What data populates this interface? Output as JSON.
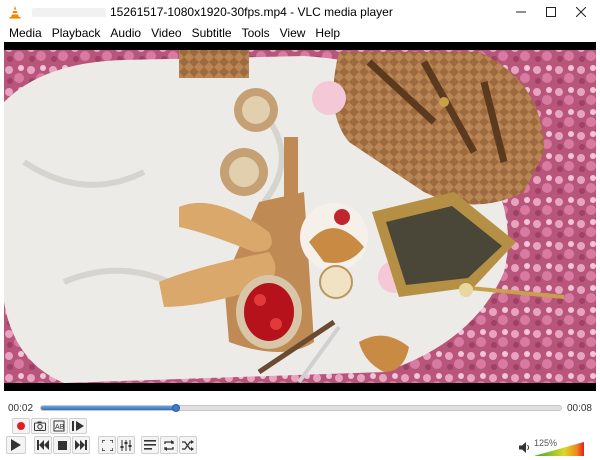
{
  "window": {
    "title": "15261517-1080x1920-30fps.mp4 - VLC media player",
    "controls": [
      "minimize",
      "maximize",
      "close"
    ]
  },
  "menu": [
    {
      "label": "Media"
    },
    {
      "label": "Playback"
    },
    {
      "label": "Audio"
    },
    {
      "label": "Video"
    },
    {
      "label": "Subtitle"
    },
    {
      "label": "Tools"
    },
    {
      "label": "View"
    },
    {
      "label": "Help"
    }
  ],
  "player": {
    "elapsed": "00:02",
    "total": "00:08",
    "progress": 0.26,
    "volume_label": "125%",
    "volume_level": 1.0
  },
  "icons": {
    "app": "vlc-cone-icon",
    "record": "record-icon",
    "snapshot": "camera-icon",
    "loop_ab": "loop-ab-icon",
    "frame_step": "frame-step-icon",
    "play": "play-icon",
    "previous": "previous-icon",
    "stop": "stop-icon",
    "next": "next-icon",
    "fullscreen": "fullscreen-icon",
    "extended_settings": "equalizer-icon",
    "playlist": "playlist-icon",
    "loop": "loop-icon",
    "shuffle": "shuffle-icon",
    "volume": "volume-icon"
  },
  "colors": {
    "accent": "#2e6fbb",
    "record": "#e02020",
    "cone": "#f08a00"
  }
}
